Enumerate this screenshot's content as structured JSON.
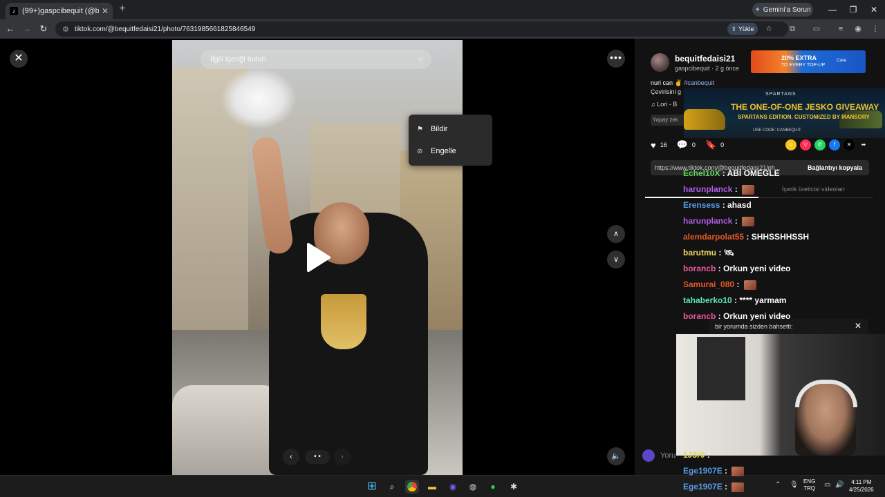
{
  "browser": {
    "tab_title": "(99+)gaspcibequit (@bequitfe",
    "tab_favicon": "tiktok-icon",
    "gemini_label": "Gemini'a Sorun",
    "url": "tiktok.com/@bequitfedaisi21/photo/7631985661825846549",
    "yukle_label": "Yükle"
  },
  "viewer": {
    "search_placeholder": "İlgili içeriği bulun",
    "menu": [
      {
        "label": "Bildir",
        "icon": "flag-icon"
      },
      {
        "label": "Engelle",
        "icon": "block-icon"
      }
    ]
  },
  "post": {
    "username": "bequitfedaisi21",
    "subline": "gaspcibequit · 2 g önce",
    "caption": "nuri can ✌",
    "hashtag": "#canbequit",
    "translate": "Çevirisini g",
    "music": "♫  Lori - B",
    "ai_label": "Yapay zek",
    "likes": "16",
    "comments": "0",
    "saves": "0",
    "link": "https://www.tiktok.com/@bequitfedaisi21/ph...",
    "copy_label": "Bağlantıyı kopyala",
    "tab_creator_videos": "İçerik üreticisi videoları",
    "comment_placeholder": "Yoru"
  },
  "ads": {
    "ad1_line1": "20% EXTRA",
    "ad1_line2": "TO EVERY TOP-UP",
    "ad1_brand": "Case",
    "ad2_brand": "SPARTANS",
    "ad2_headline": "THE ONE-OF-ONE JESKO GIVEAWAY",
    "ad2_sub": "SPARTANS EDITION. CUSTOMIZED BY MANSORY",
    "ad2_code": "USE CODE: CANBEQUIT"
  },
  "chat": [
    {
      "user": "Echel10X",
      "color": "#5cd45c",
      "msg": "ABİ OMEGLE"
    },
    {
      "user": "harunplanck",
      "color": "#b05ce6",
      "msg": "",
      "emote": true
    },
    {
      "user": "Erensess",
      "color": "#5a9be6",
      "msg": "ahasd"
    },
    {
      "user": "harunplanck",
      "color": "#b05ce6",
      "msg": "",
      "emote": true
    },
    {
      "user": "alemdarpolat55",
      "color": "#e6572a",
      "msg": "SHHSSHHSSH"
    },
    {
      "user": "barutmu",
      "color": "#e6d95a",
      "msg": "🛰"
    },
    {
      "user": "borancb",
      "color": "#e85a9a",
      "msg": "Orkun yeni video"
    },
    {
      "user": "Samurai_080",
      "color": "#e6572a",
      "msg": "",
      "emote": true
    },
    {
      "user": "tahaberko10",
      "color": "#5ce6b5",
      "msg": "**** yarmam"
    },
    {
      "user": "borancb",
      "color": "#e85a9a",
      "msg": "Orkun yeni video"
    },
    {
      "user": "1J3r0",
      "color": "#e6d95a",
      "msg": ""
    },
    {
      "user": "Ege1907E",
      "color": "#5a9be6",
      "msg": "",
      "emote": true
    },
    {
      "user": "Ege1907E",
      "color": "#5a9be6",
      "msg": "",
      "emote": true
    }
  ],
  "notification": "bir yorumda sizden bahsetti:",
  "taskbar": {
    "lang_top": "ENG",
    "lang_bottom": "TRQ",
    "time": "4:11 PM",
    "date": "4/25/2026"
  }
}
